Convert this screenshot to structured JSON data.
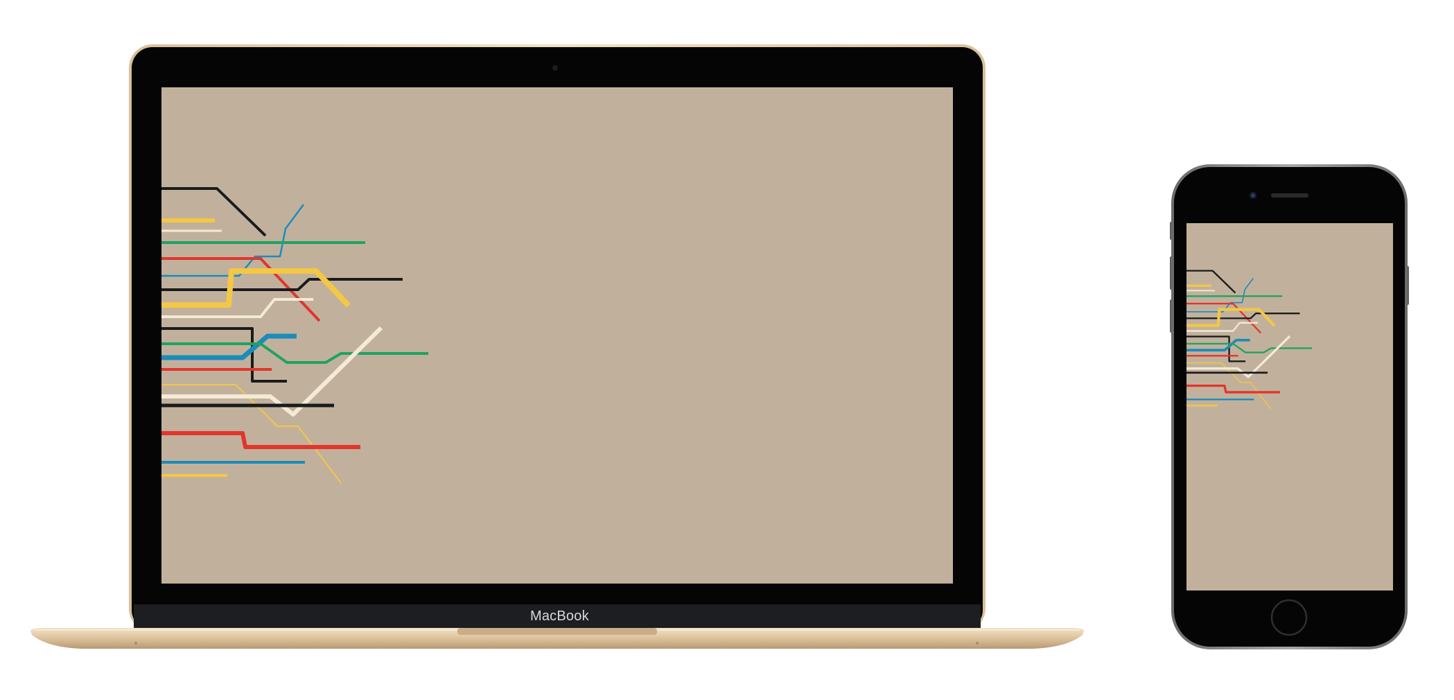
{
  "macbook": {
    "brand_label": "MacBook",
    "finish_color": "#e6cfae",
    "bezel_color": "#050505",
    "screen_color": "#c1b19c"
  },
  "iphone": {
    "body_color": "#2b2b2d",
    "screen_color": "#c1b19c"
  },
  "wallpaper": {
    "line_colors": [
      "#1b1b1d",
      "#f4c744",
      "#f3ead7",
      "#1fa362",
      "#e2352c",
      "#1b8cba"
    ]
  }
}
